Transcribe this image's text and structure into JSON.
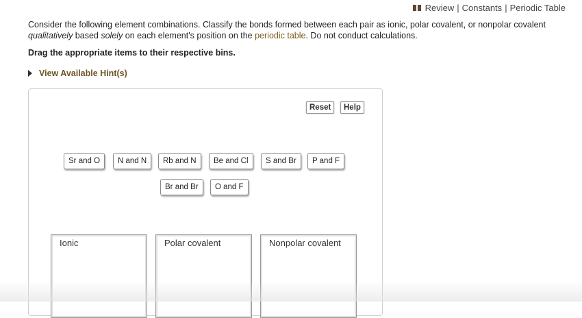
{
  "toplinks": {
    "review": "Review",
    "constants": "Constants",
    "periodic_table": "Periodic Table",
    "sep": "|"
  },
  "question": {
    "part1": "Consider the following element combinations. Classify the bonds formed between each pair as ionic, polar covalent, or nonpolar covalent ",
    "part2_italic": "qualitatively",
    "part3": " based ",
    "part4_italic": "solely",
    "part5": " on each element's position on the ",
    "link": "periodic table",
    "part6": ". Do not conduct calculations."
  },
  "instruction": "Drag the appropriate items to their respective bins.",
  "hint": "View Available Hint(s)",
  "buttons": {
    "reset": "Reset",
    "help": "Help"
  },
  "items": [
    "Sr and O",
    "N and N",
    "Rb and N",
    "Be and Cl",
    "S and Br",
    "P and F",
    "Br and Br",
    "O and F"
  ],
  "bins": [
    "Ionic",
    "Polar covalent",
    "Nonpolar covalent"
  ]
}
